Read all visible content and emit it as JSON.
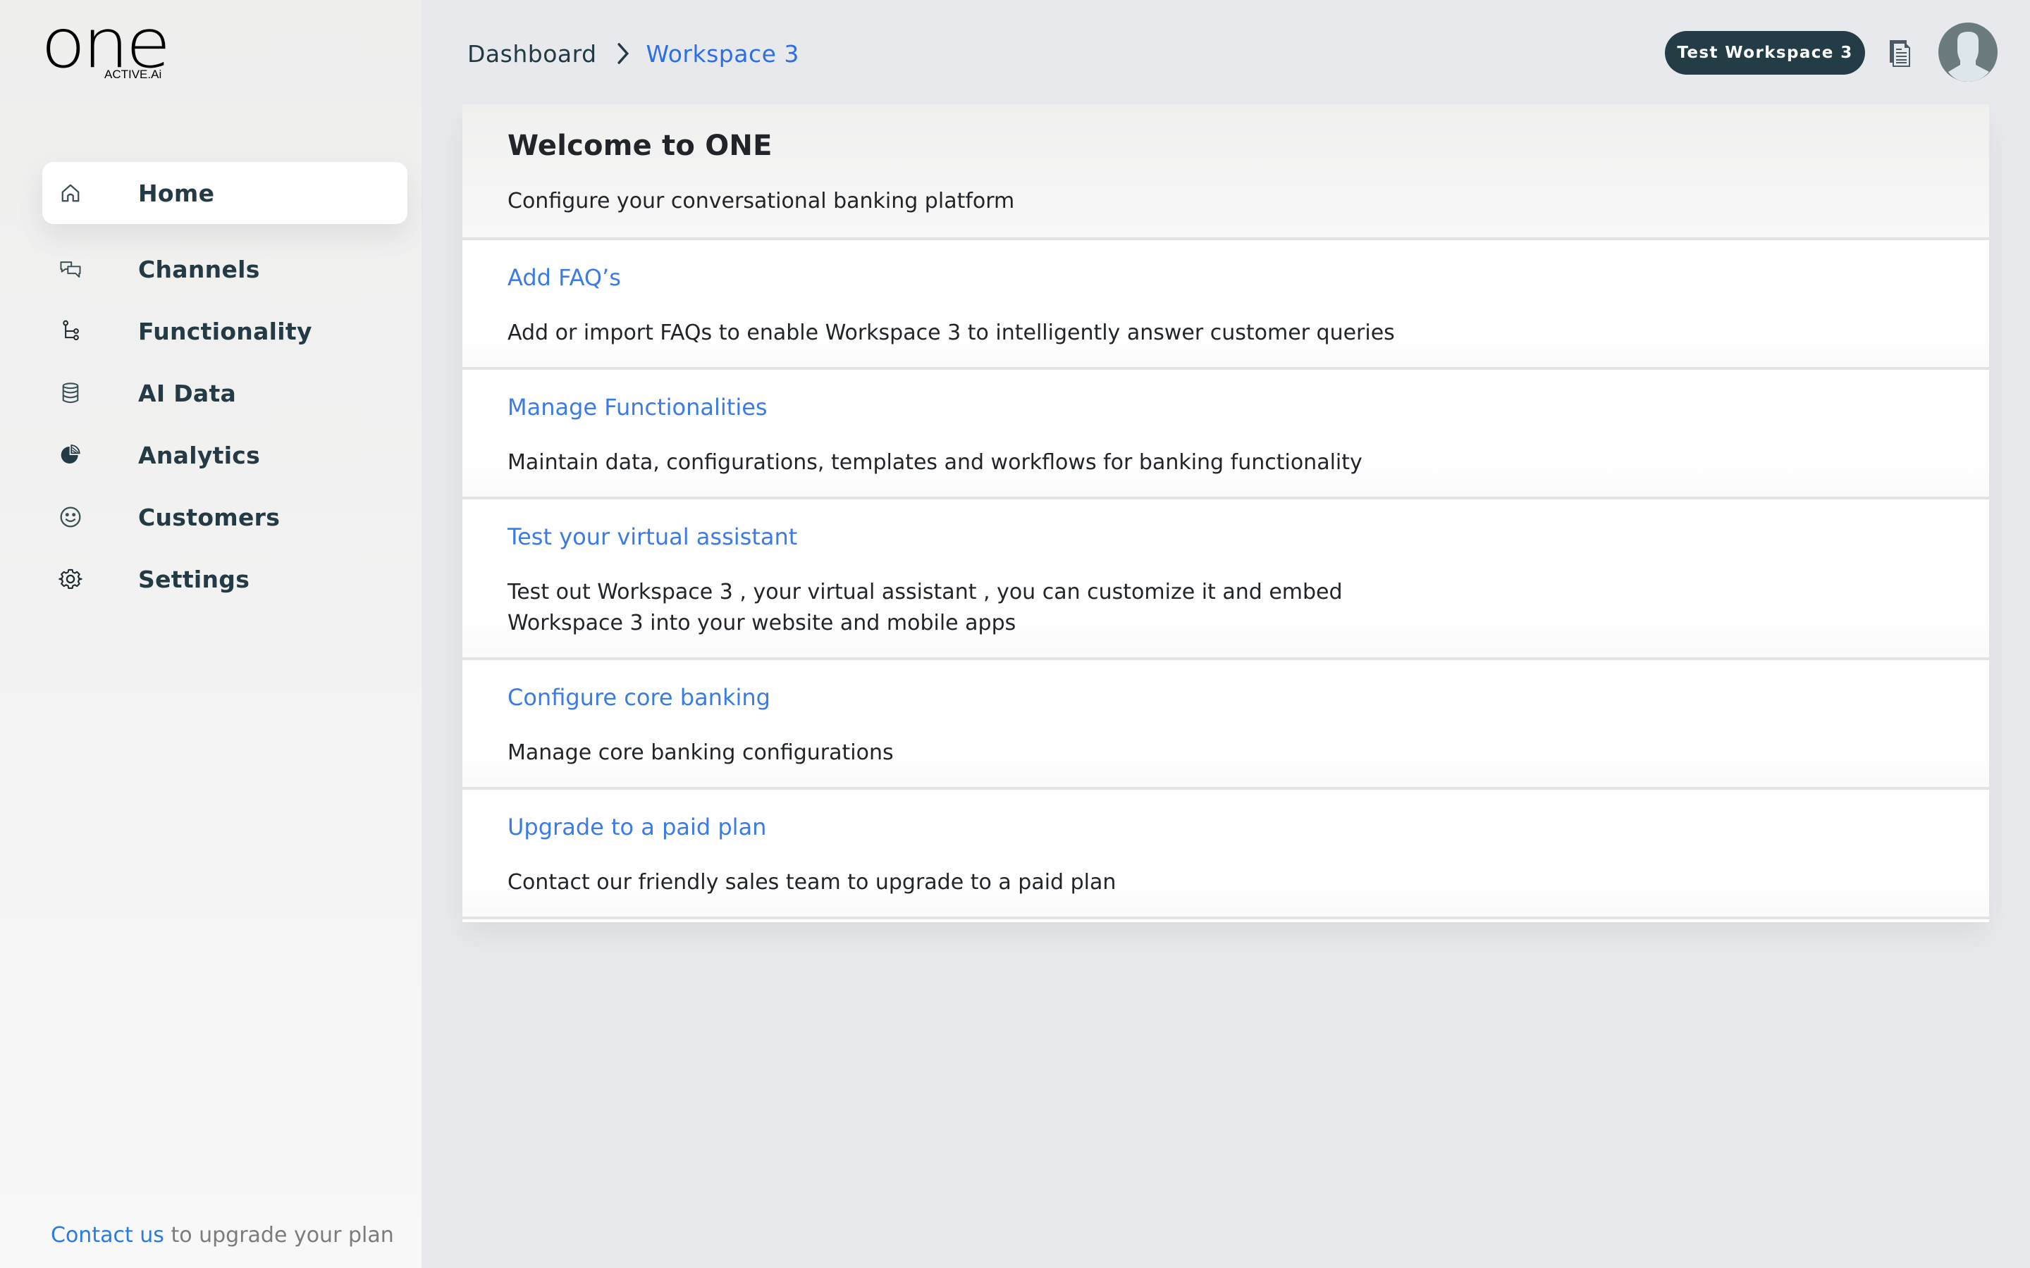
{
  "app": {
    "logo_word": "one",
    "logo_sub": "ACTIVE.Ai"
  },
  "sidebar": {
    "items": [
      {
        "label": "Home",
        "icon": "home-icon",
        "active": true
      },
      {
        "label": "Channels",
        "icon": "chat-bubbles-icon"
      },
      {
        "label": "Functionality",
        "icon": "flow-tree-icon"
      },
      {
        "label": "AI Data",
        "icon": "database-icon"
      },
      {
        "label": "Analytics",
        "icon": "pie-chart-icon"
      },
      {
        "label": "Customers",
        "icon": "smiley-icon"
      },
      {
        "label": "Settings",
        "icon": "gear-icon"
      }
    ],
    "footer": {
      "link_label": "Contact us",
      "text": " to upgrade your plan"
    }
  },
  "header": {
    "breadcrumb": [
      "Dashboard",
      "Workspace 3"
    ],
    "workspace_pill": "Test Workspace 3",
    "doc_icon": "document-icon",
    "avatar_icon": "user-avatar-icon"
  },
  "colors": {
    "accent_blue": "#2a6fe8",
    "link_blue": "#3b7be6",
    "pill_bg": "#233c45",
    "nav_text": "#243a44"
  },
  "main": {
    "title": "Welcome to ONE",
    "subtitle": "Configure your conversational banking platform",
    "sections": [
      {
        "title": "Add FAQ’s",
        "description": "Add or import FAQs to enable Workspace 3 to intelligently answer customer queries"
      },
      {
        "title": "Manage Functionalities",
        "description": "Maintain data, configurations, templates and workflows for banking functionality"
      },
      {
        "title": "Test your virtual assistant",
        "description": "Test out Workspace 3 , your virtual assistant , you can customize it and embed Workspace 3 into your website and mobile apps"
      },
      {
        "title": "Configure core banking",
        "description": "Manage core banking configurations"
      },
      {
        "title": "Upgrade to a paid plan",
        "description": "Contact our friendly sales team to upgrade to a paid plan"
      }
    ]
  }
}
